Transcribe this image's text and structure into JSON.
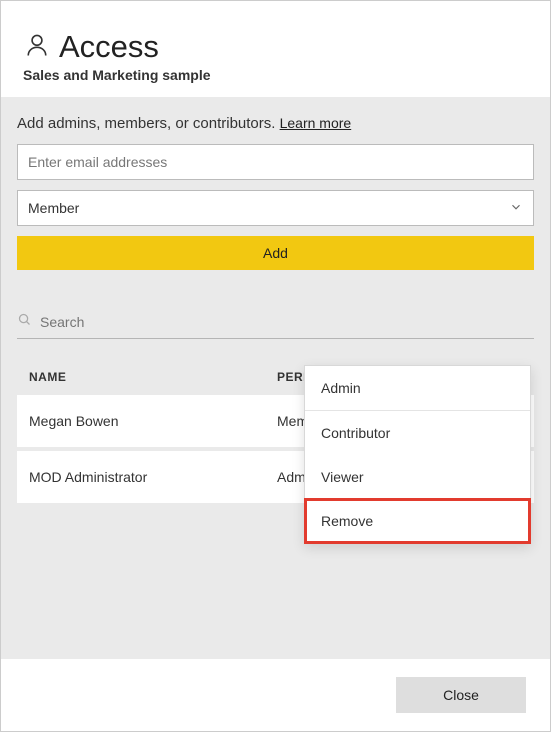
{
  "header": {
    "title": "Access",
    "subtitle": "Sales and Marketing sample"
  },
  "intro": {
    "text": "Add admins, members, or contributors. ",
    "learn_more": "Learn more"
  },
  "form": {
    "email_placeholder": "Enter email addresses",
    "role_selected": "Member",
    "add_label": "Add"
  },
  "search": {
    "placeholder": "Search"
  },
  "table": {
    "head_name": "NAME",
    "head_permission": "PERMISSION",
    "rows": [
      {
        "name": "Megan Bowen",
        "permission": "Member"
      },
      {
        "name": "MOD Administrator",
        "permission": "Admin"
      }
    ],
    "more_glyph": "..."
  },
  "dropdown": {
    "items": [
      "Admin",
      "Contributor",
      "Viewer",
      "Remove"
    ]
  },
  "footer": {
    "close": "Close"
  }
}
